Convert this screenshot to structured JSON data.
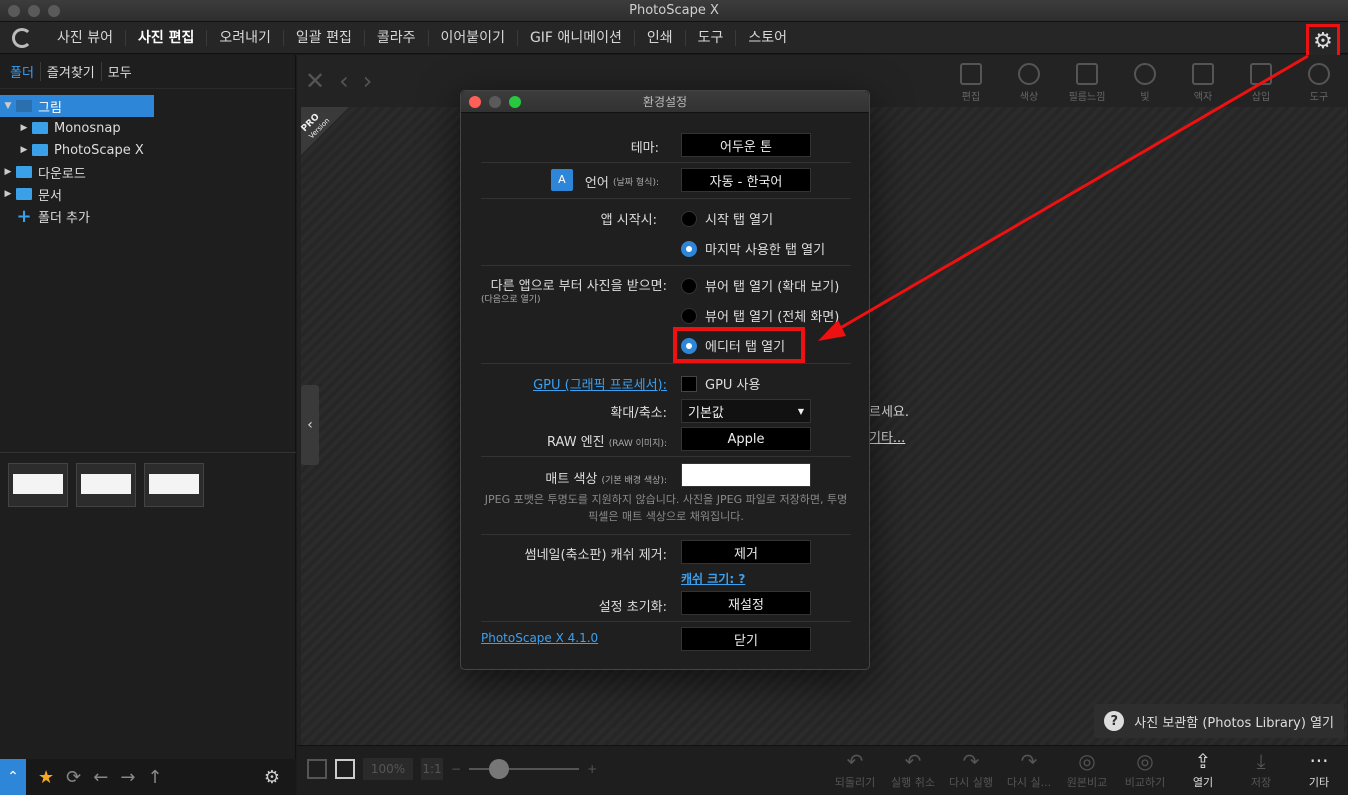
{
  "window": {
    "title": "PhotoScape X"
  },
  "menu": {
    "items": [
      "사진 뷰어",
      "사진 편집",
      "오려내기",
      "일괄 편집",
      "콜라주",
      "이어붙이기",
      "GIF 애니메이션",
      "인쇄",
      "도구",
      "스토어"
    ],
    "active": "사진 편집",
    "settings_icon": "gear-icon"
  },
  "sidebar": {
    "tabs": [
      "폴더",
      "즐겨찾기",
      "모두"
    ],
    "tree": [
      {
        "label": "그림",
        "selected": true,
        "expanded": true
      },
      {
        "label": "Monosnap",
        "indent": 1
      },
      {
        "label": "PhotoScape X",
        "indent": 1
      },
      {
        "label": "다운로드"
      },
      {
        "label": "문서"
      }
    ],
    "add_folder": "폴더 추가"
  },
  "toolbar": {
    "tools": [
      "편집",
      "색상",
      "필름느낌",
      "빛",
      "액자",
      "삽입",
      "도구"
    ]
  },
  "canvas": {
    "pro_badge": "PRO",
    "pro_sub": "Version",
    "behind_text_1": "르세요.",
    "behind_text_2": "기타...",
    "library_button": "사진 보관함 (Photos Library) 열기"
  },
  "bottom": {
    "zoom": "100%",
    "zoom_fit": "1:1",
    "actions": [
      "되돌리기",
      "실행 취소",
      "다시 실행",
      "다시 실...",
      "원본비교",
      "비교하기",
      "열기",
      "저장",
      "기타"
    ]
  },
  "dialog": {
    "title": "환경설정",
    "theme_label": "테마:",
    "theme_value": "어두운 톤",
    "lang_label": "언어",
    "lang_sub": "(날짜 형식):",
    "lang_value": "자동 - 한국어",
    "start_label": "앱 시작시:",
    "start_opt1": "시작 탭 열기",
    "start_opt2": "마지막 사용한 탭 열기",
    "recv_label": "다른 앱으로 부터 사진을 받으면:",
    "recv_sub": "(다음으로 열기)",
    "recv_opt1": "뷰어 탭 열기 (확대 보기)",
    "recv_opt2": "뷰어 탭 열기 (전체 화면)",
    "recv_opt3": "에디터 탭 열기",
    "gpu_label": "GPU (그래픽 프로세서):",
    "gpu_check": "GPU 사용",
    "zoom_label": "확대/축소:",
    "zoom_value": "기본값",
    "raw_label": "RAW 엔진",
    "raw_sub": "(RAW 이미지):",
    "raw_value": "Apple",
    "matte_label": "매트 색상",
    "matte_sub": "(기본 배경 색상):",
    "matte_note": "JPEG 포맷은 투명도를 지원하지 않습니다. 사진을 JPEG 파일로 저장하면, 투명 픽셀은 매트 색상으로 채워집니다.",
    "cache_label": "썸네일(축소판) 캐쉬 제거:",
    "cache_button": "제거",
    "cache_size_link": "캐쉬 크기: ?",
    "reset_label": "설정 초기화:",
    "reset_button": "재설정",
    "version_link": "PhotoScape X 4.1.0",
    "close_button": "닫기"
  },
  "colors": {
    "accent": "#2e86d8",
    "highlight": "#ee1111"
  }
}
